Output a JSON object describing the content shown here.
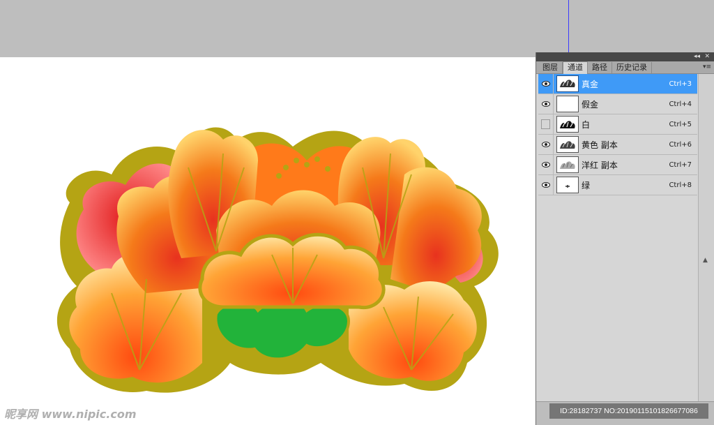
{
  "panel": {
    "tabs": [
      {
        "label": "图层",
        "active": false
      },
      {
        "label": "通道",
        "active": true
      },
      {
        "label": "路径",
        "active": false
      },
      {
        "label": "历史记录",
        "active": false
      }
    ],
    "collapse_icon": "double-chevron-right-icon",
    "close_icon": "close-icon",
    "menu_icon": "panel-menu-icon",
    "channels": [
      {
        "name": "真金",
        "shortcut": "Ctrl+3",
        "visible": true,
        "selected": true
      },
      {
        "name": "假金",
        "shortcut": "Ctrl+4",
        "visible": true,
        "selected": false
      },
      {
        "name": "白",
        "shortcut": "Ctrl+5",
        "visible": false,
        "selected": false
      },
      {
        "name": "黄色 副本",
        "shortcut": "Ctrl+6",
        "visible": true,
        "selected": false
      },
      {
        "name": "洋红 副本",
        "shortcut": "Ctrl+7",
        "visible": true,
        "selected": false
      },
      {
        "name": "绿",
        "shortcut": "Ctrl+8",
        "visible": true,
        "selected": false
      }
    ]
  },
  "watermark": {
    "site": "昵享网 www.nipic.com",
    "id_text": "ID:28182737 NO:20190115101826677086"
  },
  "colors": {
    "selection": "#3f9af7",
    "guide": "#3b3bff",
    "petal_orange": "#f5a623",
    "petal_red": "#e8321e",
    "outline_gold": "#b5a414",
    "leaf_green": "#22b33a"
  }
}
